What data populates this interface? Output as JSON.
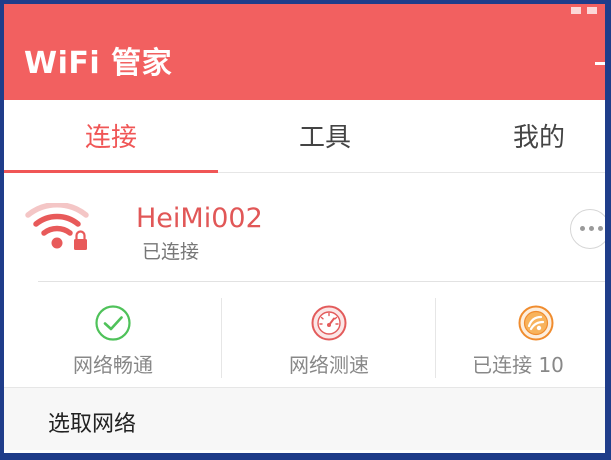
{
  "app": {
    "title": "WiFi 管家"
  },
  "tabs": [
    {
      "label": "连接",
      "active": true
    },
    {
      "label": "工具",
      "active": false
    },
    {
      "label": "我的",
      "active": false
    }
  ],
  "connection": {
    "ssid": "HeiMi002",
    "status": "已连接",
    "icon": "wifi-locked-icon",
    "more_icon": "more-dots-icon"
  },
  "stats": [
    {
      "label": "网络畅通",
      "icon": "check-circle-icon"
    },
    {
      "label": "网络测速",
      "icon": "speedometer-icon"
    },
    {
      "label": "已连接 10",
      "icon": "connected-devices-icon"
    }
  ],
  "section": {
    "title": "选取网络"
  },
  "colors": {
    "accent": "#f26060",
    "ssid": "#e15757",
    "check_green": "#4fc25a",
    "speed_red": "#e35b5b",
    "devices_orange": "#f08c2e",
    "frame": "#1f3d8a"
  }
}
